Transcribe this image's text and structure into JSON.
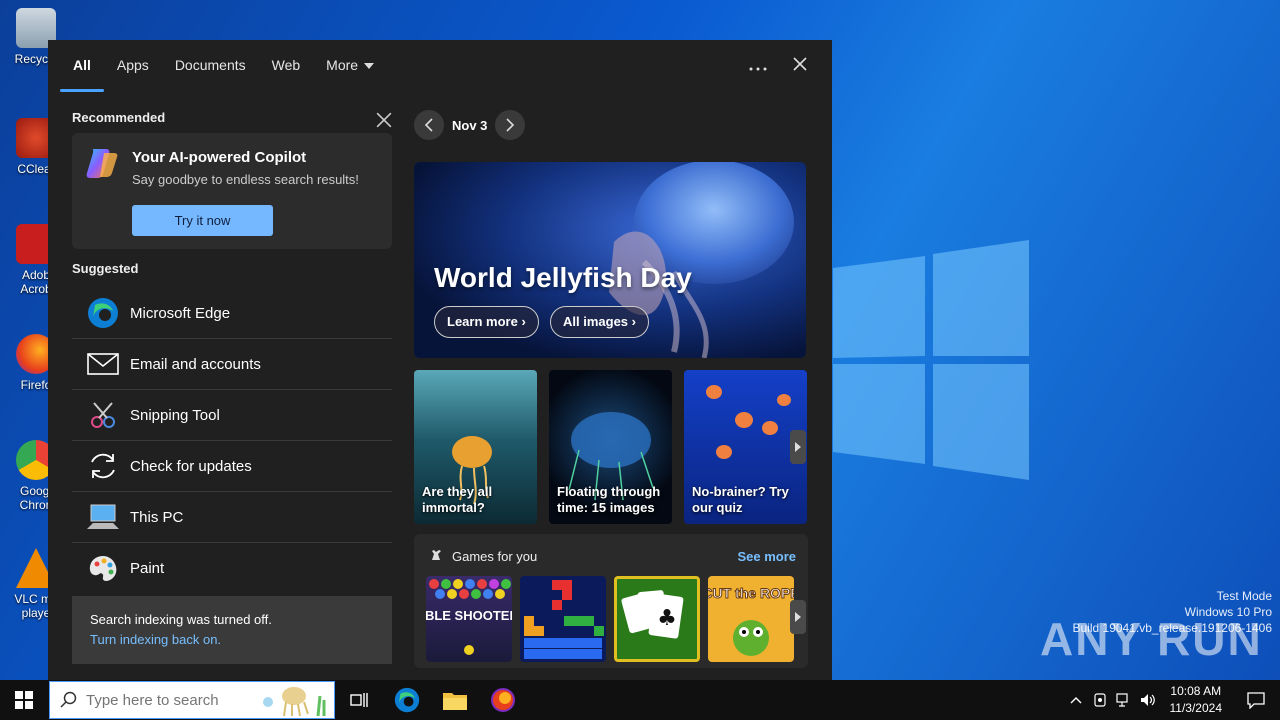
{
  "desktop": {
    "icons": [
      {
        "label": "Recycle"
      },
      {
        "label": "CClear"
      },
      {
        "label": "Adob Acrob"
      },
      {
        "label": "Firefo"
      },
      {
        "label": "Googl Chron"
      },
      {
        "label": "VLC me playe"
      }
    ],
    "watermark": {
      "line1": "Test Mode",
      "line2": "Windows 10 Pro",
      "line3": "Build 19041.vb_release.191206-1406"
    },
    "anyrun": "ANY RUN"
  },
  "search_panel": {
    "tabs": [
      {
        "label": "All",
        "active": true
      },
      {
        "label": "Apps"
      },
      {
        "label": "Documents"
      },
      {
        "label": "Web"
      },
      {
        "label": "More"
      }
    ],
    "recommended": {
      "title": "Recommended",
      "copilot_title": "Your AI-powered Copilot",
      "copilot_subtitle": "Say goodbye to endless search results!",
      "copilot_button": "Try it now"
    },
    "suggested": {
      "title": "Suggested",
      "items": [
        {
          "label": "Microsoft Edge",
          "icon": "edge-icon"
        },
        {
          "label": "Email and accounts",
          "icon": "mail-icon"
        },
        {
          "label": "Snipping Tool",
          "icon": "snipping-tool-icon"
        },
        {
          "label": "Check for updates",
          "icon": "refresh-icon"
        },
        {
          "label": "This PC",
          "icon": "computer-icon"
        },
        {
          "label": "Paint",
          "icon": "paint-icon"
        }
      ]
    },
    "indexing": {
      "message": "Search indexing was turned off.",
      "link": "Turn indexing back on."
    },
    "highlights": {
      "date": "Nov 3",
      "hero_title": "World Jellyfish Day",
      "learn_more": "Learn more",
      "all_images": "All images",
      "cards": [
        {
          "caption": "Are they all immortal?"
        },
        {
          "caption": "Floating through time: 15 images"
        },
        {
          "caption": "No-brainer? Try our quiz"
        }
      ],
      "games_title": "Games for you",
      "see_more": "See more",
      "games": [
        {
          "name": "BUBBLE SHOOTER HD"
        },
        {
          "name": "Block puzzle"
        },
        {
          "name": "Solitaire"
        },
        {
          "name": "CUT the ROPE"
        }
      ]
    }
  },
  "taskbar": {
    "search_placeholder": "Type here to search",
    "time": "10:08 AM",
    "date": "11/3/2024"
  }
}
